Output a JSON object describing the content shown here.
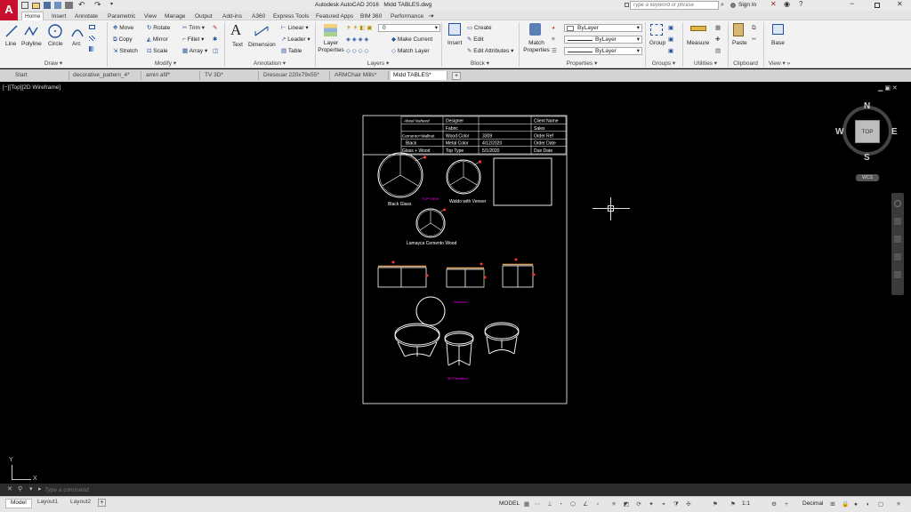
{
  "title_bar": {
    "app_title": "Autodesk AutoCAD 2016",
    "file_name": "Midd TABLES.dwg",
    "search_placeholder": "Type a keyword or phrase",
    "sign_in": "Sign In"
  },
  "ribbon_tabs": [
    "Home",
    "Insert",
    "Annotate",
    "Parametric",
    "View",
    "Manage",
    "Output",
    "Add-ins",
    "A360",
    "Express Tools",
    "Featured Apps",
    "BIM 360",
    "Performance"
  ],
  "draw_panel": {
    "label": "Draw",
    "line": "Line",
    "polyline": "Polyline",
    "circle": "Circle",
    "arc": "Arc"
  },
  "modify_panel": {
    "label": "Modify",
    "move": "Move",
    "copy": "Copy",
    "stretch": "Stretch",
    "rotate": "Rotate",
    "mirror": "Mirror",
    "scale": "Scale",
    "trim": "Trim",
    "fillet": "Fillet",
    "array": "Array"
  },
  "annotation_panel": {
    "label": "Annotation",
    "text": "Text",
    "dimension": "Dimension",
    "linear": "Linear",
    "leader": "Leader",
    "table": "Table"
  },
  "layers_panel": {
    "label": "Layers",
    "layer_properties": "Layer Properties",
    "current_layer": "0",
    "make_current": "Make Current",
    "match_layer": "Match Layer"
  },
  "block_panel": {
    "label": "Block",
    "insert": "Insert",
    "create": "Create",
    "edit": "Edit",
    "edit_attributes": "Edit Attributes"
  },
  "properties_panel": {
    "label": "Properties",
    "match_properties": "Match Properties",
    "color": "ByLayer",
    "linetype": "ByLayer",
    "lineweight": "ByLayer"
  },
  "groups_panel": {
    "label": "Groups",
    "group": "Group"
  },
  "utilities_panel": {
    "label": "Utilities",
    "measure": "Measure"
  },
  "clipboard_panel": {
    "label": "Clipboard",
    "paste": "Paste"
  },
  "view_panel": {
    "label": "View",
    "base": "Base"
  },
  "doc_tabs": [
    "Start",
    "decorative_pattern_4*",
    "amin afif*",
    "TV 3D*",
    "Dresouar 220x79x55*",
    "ARMChair Mills*",
    "Midd TABLES*"
  ],
  "viewport_label": "[−][Top][2D Wireframe]",
  "viewcube": {
    "n": "N",
    "s": "S",
    "e": "E",
    "w": "W",
    "top": "TOP",
    "wcs": "WCS"
  },
  "ucs": {
    "y": "Y",
    "x": "X"
  },
  "command": {
    "placeholder": "Type a command"
  },
  "layout_tabs": [
    "Model",
    "Layout1",
    "Layout2"
  ],
  "status": {
    "model": "MODEL",
    "scale": "1:1",
    "units": "Decimal"
  },
  "drawing": {
    "title_block": [
      [
        "Aheel Naheed",
        "Designer",
        "",
        "Client Name"
      ],
      [
        "",
        "Fabric",
        "",
        "Sales"
      ],
      [
        "Cemento+Wallnut",
        "Wood Color",
        "3309",
        "Order Ref"
      ],
      [
        "Black",
        "Metal Color",
        "4/12/2020",
        "Order Date"
      ],
      [
        "Glass + Wood",
        "Top Type",
        "5/1/2020",
        "Due Date"
      ]
    ],
    "top_view_label": "TOP VIEW",
    "table_labels": [
      "Black Glass",
      "Waldo with Veneer",
      "Lamayca Cemento Wood"
    ],
    "sections_label": "Sections",
    "threed_label": "3D Elevation"
  }
}
